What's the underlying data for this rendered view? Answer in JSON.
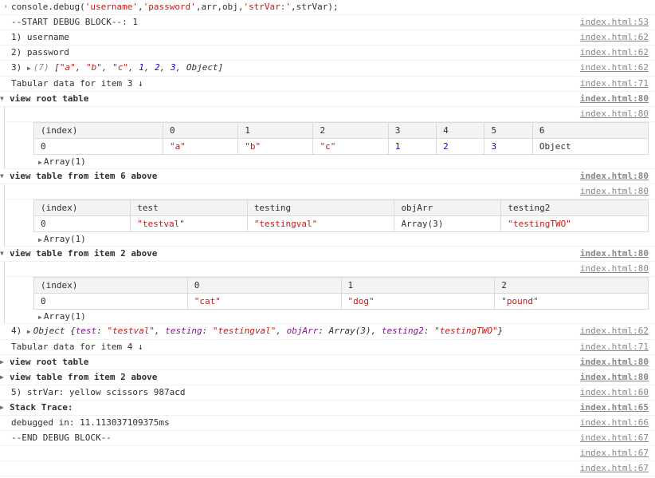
{
  "cmd": {
    "fn": "console.debug",
    "args_str": "('username','password',arr,obj,'strVar:',strVar);",
    "arg1": "'username'",
    "arg2": "'password'",
    "arg3": "arr",
    "arg4": "obj",
    "arg5": "'strVar:'",
    "arg6": "strVar"
  },
  "src": {
    "file": "index.html",
    "l53": "index.html:53",
    "l60": "index.html:60",
    "l62": "index.html:62",
    "l65": "index.html:65",
    "l66": "index.html:66",
    "l67": "index.html:67",
    "l71": "index.html:71",
    "l80": "index.html:80"
  },
  "lines": {
    "start": "--START DEBUG BLOCK--: 1",
    "end": "--END DEBUG BLOCK--",
    "i1": "1)  username",
    "i2": "2)  password",
    "i3_pre": "3)  ",
    "i3_count": "(7)",
    "i3_arr": " [\"a\", \"b\", \"c\", 1, 2, 3, Object]",
    "tab3": "Tabular data for item 3 ↓",
    "tab4": "Tabular data for item 4 ↓",
    "vrt": "view root table",
    "v6": "view table from item 6 above",
    "v2": "view table from item 2 above",
    "i4_pre": "4)  ",
    "i4_obj_label": "Object ",
    "i5": "5)  strVar: yellow scissors 987acd",
    "stack": "Stack Trace:",
    "time": "debugged in: 11.113037109375ms",
    "arr1": "Array(1)"
  },
  "obj4": {
    "k1": "test",
    "v1": "\"testval\"",
    "k2": "testing",
    "v2": "\"testingval\"",
    "k3": "objArr",
    "v3": "Array(3)",
    "k4": "testing2",
    "v4": "\"testingTWO\""
  },
  "t1": {
    "headers": [
      "(index)",
      "0",
      "1",
      "2",
      "3",
      "4",
      "5",
      "6"
    ],
    "row0": [
      "0",
      "\"a\"",
      "\"b\"",
      "\"c\"",
      "1",
      "2",
      "3",
      "Object"
    ]
  },
  "t2": {
    "headers": [
      "(index)",
      "test",
      "testing",
      "objArr",
      "testing2"
    ],
    "row0": [
      "0",
      "\"testval\"",
      "\"testingval\"",
      "Array(3)",
      "\"testingTWO\""
    ]
  },
  "t3": {
    "headers": [
      "(index)",
      "0",
      "1",
      "2"
    ],
    "row0": [
      "0",
      "\"cat\"",
      "\"dog\"",
      "\"pound\""
    ]
  }
}
